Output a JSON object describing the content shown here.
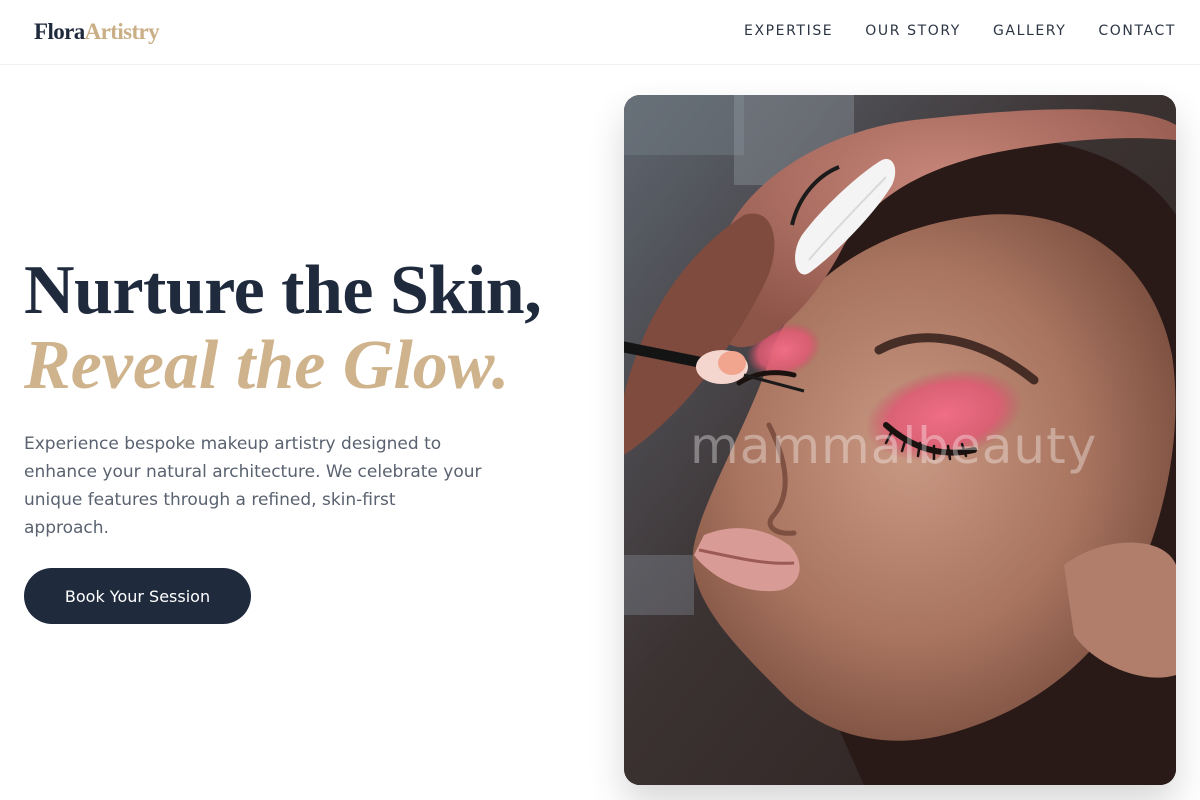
{
  "brand": {
    "name_part1": "Flora",
    "name_part2": "Artistry"
  },
  "nav": {
    "items": [
      {
        "label": "EXPERTISE"
      },
      {
        "label": "OUR STORY"
      },
      {
        "label": "GALLERY"
      },
      {
        "label": "CONTACT"
      }
    ]
  },
  "hero": {
    "title_line1": "Nurture the Skin,",
    "title_line2": "Reveal the Glow.",
    "intro": "Experience bespoke makeup artistry designed to enhance your natural architecture. We celebrate your unique features through a refined, skin-first approach.",
    "cta_label": "Book Your Session"
  },
  "photo": {
    "watermark": "mammalbeauty"
  },
  "colors": {
    "navy": "#1f2a3d",
    "gold": "#cfb38c",
    "body_text": "#5a6270"
  }
}
